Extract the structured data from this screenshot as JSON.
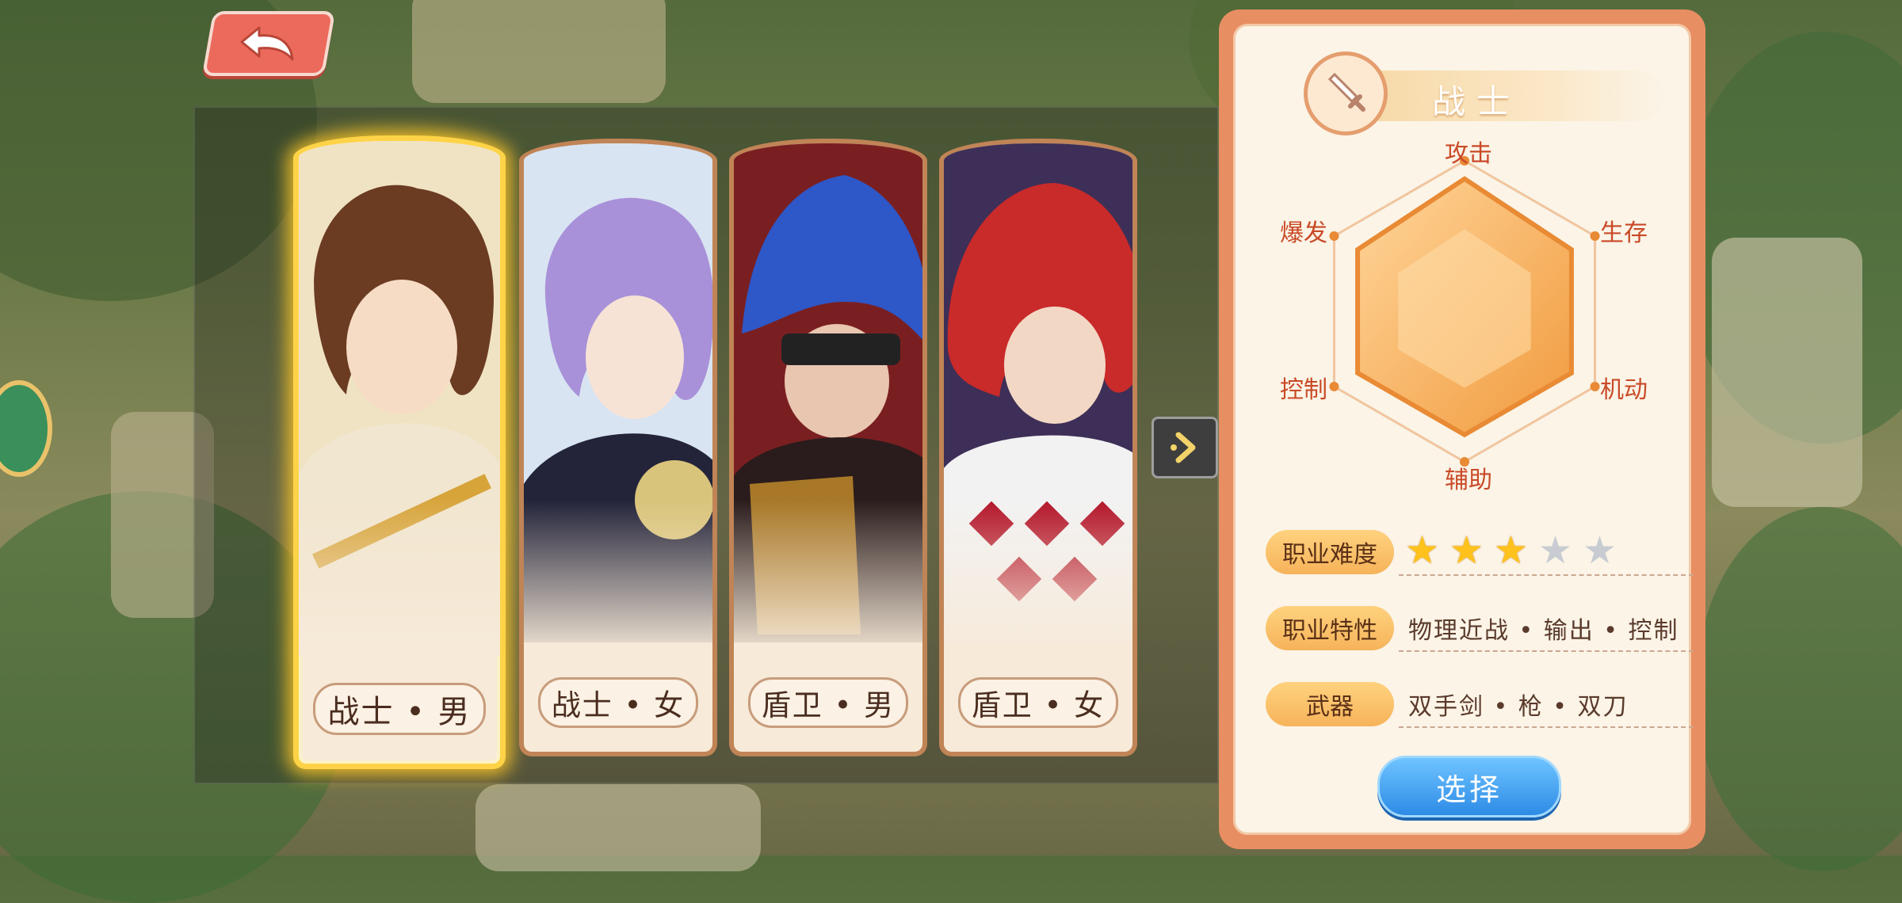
{
  "back_button": {
    "icon": "back-arrow-icon"
  },
  "characters": [
    {
      "label": "战士 • 男",
      "selected": true,
      "hair": "#6b3b22",
      "outfit": "#f1e6cf",
      "accent": "#d7a43a",
      "bg": "#f0e3c3"
    },
    {
      "label": "战士 • 女",
      "selected": false,
      "hair": "#a891d9",
      "outfit": "#23243a",
      "accent": "#d9c47b",
      "bg": "#d9e4f2"
    },
    {
      "label": "盾卫 • 男",
      "selected": false,
      "hair": "#2e57c7",
      "outfit": "#2a1c1c",
      "accent": "#c8902c",
      "bg": "#7a1f21"
    },
    {
      "label": "盾卫 • 女",
      "selected": false,
      "hair": "#c92a2a",
      "outfit": "#f2f2f2",
      "accent": "#b3162b",
      "bg": "#3d2f57"
    }
  ],
  "next_button": {
    "icon": "chevron-right-icon"
  },
  "info": {
    "class_icon": "sword-icon",
    "class_name": "战士",
    "radar": {
      "labels": [
        "攻击",
        "生存",
        "机动",
        "辅助",
        "控制",
        "爆发"
      ],
      "values": [
        0.88,
        0.82,
        0.82,
        0.82,
        0.82,
        0.82
      ]
    },
    "difficulty_label": "职业难度",
    "difficulty_stars": 3,
    "difficulty_max": 5,
    "traits_label": "职业特性",
    "traits_value": "物理近战 • 输出 • 控制",
    "weapon_label": "武器",
    "weapon_value": "双手剑 • 枪 • 双刀"
  },
  "select_button": "选择",
  "colors": {
    "accent": "#e88e63",
    "select_blue": "#2d8be6",
    "radar_fill": "#f6a64b"
  }
}
